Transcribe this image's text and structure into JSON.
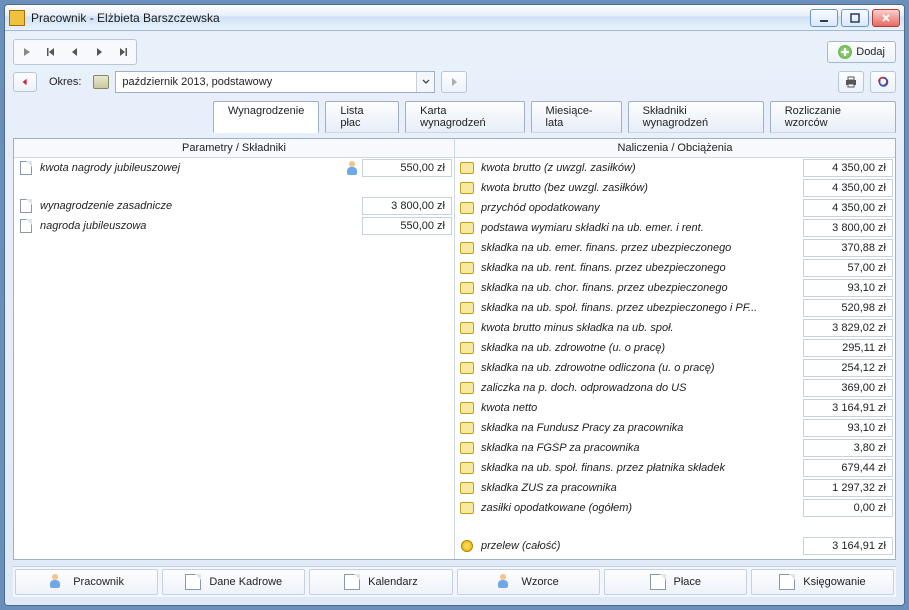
{
  "window": {
    "title": "Pracownik - Elżbieta Barszczewska"
  },
  "toolbar": {
    "add_label": "Dodaj"
  },
  "period": {
    "label": "Okres:",
    "value": "październik 2013, podstawowy"
  },
  "tabs": {
    "wynagrodzenie": "Wynagrodzenie",
    "lista_plac": "Lista płac",
    "karta": "Karta wynagrodzeń",
    "miesiace": "Miesiące-lata",
    "skladniki": "Składniki wynagrodzeń",
    "rozliczanie": "Rozliczanie wzorców"
  },
  "columns": {
    "left": "Parametry / Składniki",
    "right": "Naliczenia / Obciążenia"
  },
  "left_rows": [
    {
      "icon": "doc",
      "label": "kwota nagrody jubileuszowej",
      "extra_icon": "person",
      "value": "550,00 zł"
    },
    {
      "blank": true
    },
    {
      "icon": "doc2",
      "label": "wynagrodzenie zasadnicze",
      "value": "3 800,00 zł"
    },
    {
      "icon": "doc2",
      "label": "nagroda jubileuszowa",
      "value": "550,00 zł"
    }
  ],
  "right_rows": [
    {
      "icon": "scroll",
      "label": "kwota brutto (z uwzgl. zasiłków)",
      "value": "4 350,00 zł"
    },
    {
      "icon": "scroll",
      "label": "kwota brutto (bez uwzgl. zasiłków)",
      "value": "4 350,00 zł"
    },
    {
      "icon": "scroll",
      "label": "przychód opodatkowany",
      "value": "4 350,00 zł"
    },
    {
      "icon": "scroll",
      "label": "podstawa wymiaru składki na ub. emer. i rent.",
      "value": "3 800,00 zł"
    },
    {
      "icon": "scroll",
      "label": "składka na ub. emer. finans. przez ubezpieczonego",
      "value": "370,88 zł"
    },
    {
      "icon": "scroll",
      "label": "składka na ub. rent. finans. przez ubezpieczonego",
      "value": "57,00 zł"
    },
    {
      "icon": "scroll",
      "label": "składka na ub. chor. finans. przez ubezpieczonego",
      "value": "93,10 zł"
    },
    {
      "icon": "scroll",
      "label": "składka na ub. społ. finans. przez ubezpieczonego i PF...",
      "value": "520,98 zł"
    },
    {
      "icon": "scroll",
      "label": "kwota brutto minus składka na ub. społ.",
      "value": "3 829,02 zł"
    },
    {
      "icon": "scroll",
      "label": "składka na ub. zdrowotne (u. o pracę)",
      "value": "295,11 zł"
    },
    {
      "icon": "scroll",
      "label": "składka na ub. zdrowotne odliczona (u. o pracę)",
      "value": "254,12 zł"
    },
    {
      "icon": "scroll",
      "label": "zaliczka na p. doch. odprowadzona do US",
      "value": "369,00 zł"
    },
    {
      "icon": "scroll",
      "label": "kwota netto",
      "value": "3 164,91 zł"
    },
    {
      "icon": "scroll",
      "label": "składka na Fundusz Pracy za pracownika",
      "value": "93,10 zł"
    },
    {
      "icon": "scroll",
      "label": "składka na FGŚP za pracownika",
      "value": "3,80 zł"
    },
    {
      "icon": "scroll",
      "label": "składka na ub. społ. finans. przez płatnika składek",
      "value": "679,44 zł"
    },
    {
      "icon": "scroll",
      "label": "składka ZUS za pracownika",
      "value": "1 297,32 zł"
    },
    {
      "icon": "scroll",
      "label": "zasiłki opodatkowane (ogółem)",
      "value": "0,00 zł"
    },
    {
      "blank": true
    },
    {
      "icon": "coin",
      "label": "przelew (całość)",
      "value": "3 164,91 zł"
    }
  ],
  "footer_tabs": {
    "pracownik": "Pracownik",
    "dane": "Dane Kadrowe",
    "kalendarz": "Kalendarz",
    "wzorce": "Wzorce",
    "place": "Płace",
    "ksiegowanie": "Księgowanie"
  }
}
